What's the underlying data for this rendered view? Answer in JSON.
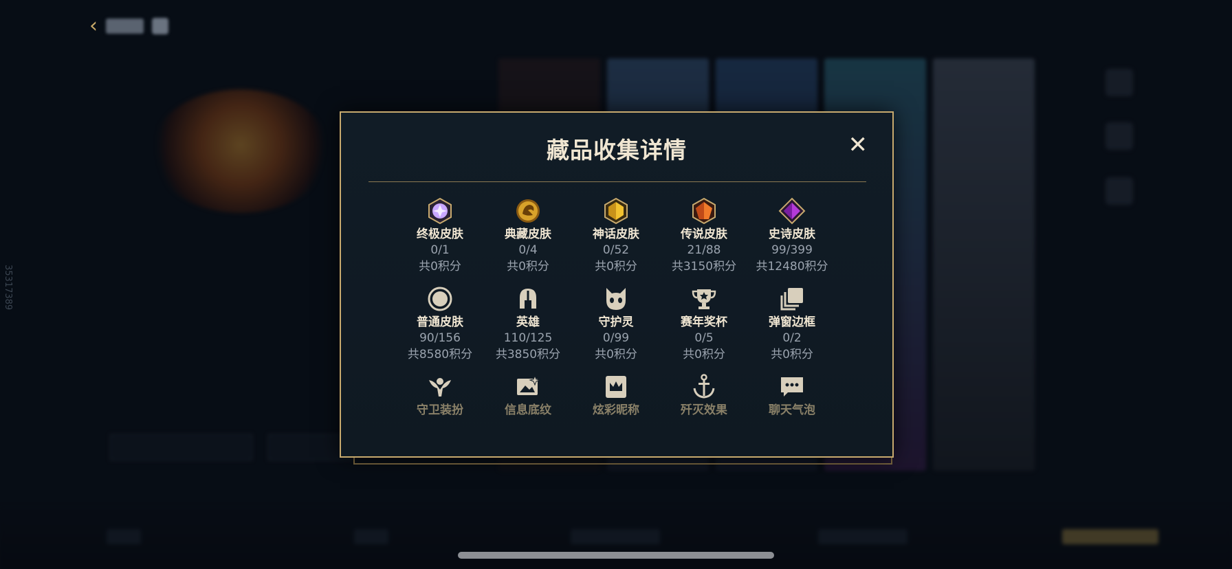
{
  "modal": {
    "title": "藏品收集详情",
    "close_label": "✕"
  },
  "background": {
    "side_id": "35317389"
  },
  "items": [
    {
      "name": "终极皮肤",
      "count": "0/1",
      "points": "共0积分",
      "icon": "ultimate-gem-icon",
      "color": "#c9a8ff"
    },
    {
      "name": "典藏皮肤",
      "count": "0/4",
      "points": "共0积分",
      "icon": "dragon-emblem-icon",
      "color": "#d8a22a"
    },
    {
      "name": "神话皮肤",
      "count": "0/52",
      "points": "共0积分",
      "icon": "gold-gem-icon",
      "color": "#f2c230"
    },
    {
      "name": "传说皮肤",
      "count": "21/88",
      "points": "共3150积分",
      "icon": "orange-gem-icon",
      "color": "#f07a2a"
    },
    {
      "name": "史诗皮肤",
      "count": "99/399",
      "points": "共12480积分",
      "icon": "purple-gem-icon",
      "color": "#b43ad8"
    },
    {
      "name": "普通皮肤",
      "count": "90/156",
      "points": "共8580积分",
      "icon": "circle-icon",
      "color": "#d8cfbc"
    },
    {
      "name": "英雄",
      "count": "110/125",
      "points": "共3850积分",
      "icon": "helmet-icon",
      "color": "#d8cfbc"
    },
    {
      "name": "守护灵",
      "count": "0/99",
      "points": "共0积分",
      "icon": "little-legend-icon",
      "color": "#d8cfbc"
    },
    {
      "name": "赛年奖杯",
      "count": "0/5",
      "points": "共0积分",
      "icon": "trophy-icon",
      "color": "#d8cfbc"
    },
    {
      "name": "弹窗边框",
      "count": "0/2",
      "points": "共0积分",
      "icon": "frame-stack-icon",
      "color": "#d8cfbc"
    },
    {
      "name": "守卫装扮",
      "icon": "ward-icon",
      "color": "#d8cfbc"
    },
    {
      "name": "信息底纹",
      "icon": "banner-sparkle-icon",
      "color": "#d8cfbc"
    },
    {
      "name": "炫彩昵称",
      "icon": "crown-card-icon",
      "color": "#d8cfbc"
    },
    {
      "name": "歼灭效果",
      "icon": "anchor-icon",
      "color": "#d8cfbc"
    },
    {
      "name": "聊天气泡",
      "icon": "chat-bubble-icon",
      "color": "#d8cfbc"
    }
  ]
}
